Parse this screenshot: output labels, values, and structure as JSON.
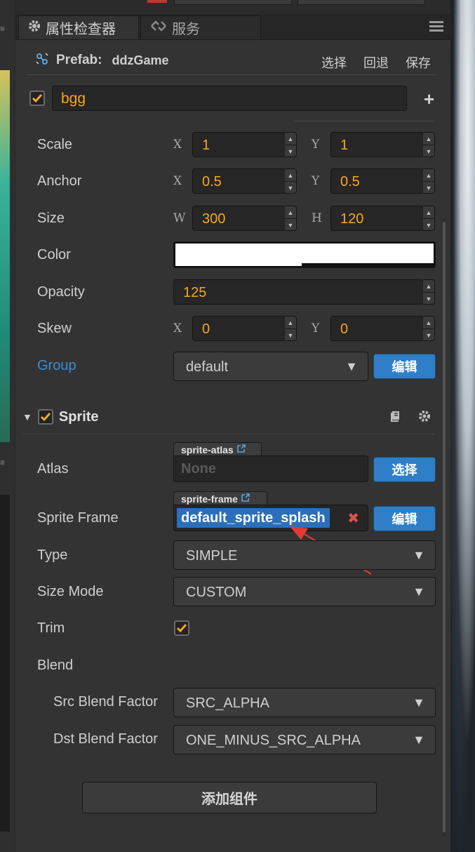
{
  "tabs": [
    {
      "label": "属性检查器",
      "icon": "gear-icon"
    },
    {
      "label": "服务",
      "icon": "link-icon"
    }
  ],
  "prefab": {
    "label": "Prefab:",
    "name": "ddzGame",
    "actions": [
      "选择",
      "回退",
      "保存"
    ]
  },
  "node": {
    "name": "bgg",
    "active": true
  },
  "properties": {
    "scale": {
      "label": "Scale",
      "x_label": "X",
      "x": "1",
      "y_label": "Y",
      "y": "1"
    },
    "anchor": {
      "label": "Anchor",
      "x_label": "X",
      "x": "0.5",
      "y_label": "Y",
      "y": "0.5"
    },
    "size": {
      "label": "Size",
      "w_label": "W",
      "w": "300",
      "h_label": "H",
      "h": "120"
    },
    "color": {
      "label": "Color",
      "value": "#ffffff",
      "alpha_fraction": 0.49
    },
    "opacity": {
      "label": "Opacity",
      "value": "125"
    },
    "skew": {
      "label": "Skew",
      "x_label": "X",
      "x": "0",
      "y_label": "Y",
      "y": "0"
    },
    "group": {
      "label": "Group",
      "value": "default",
      "edit_label": "编辑"
    }
  },
  "sprite": {
    "title": "Sprite",
    "enabled": true,
    "atlas": {
      "label": "Atlas",
      "tag": "sprite-atlas",
      "placeholder": "None",
      "select_label": "选择"
    },
    "sprite_frame": {
      "label": "Sprite Frame",
      "tag": "sprite-frame",
      "value": "default_sprite_splash",
      "edit_label": "编辑"
    },
    "type": {
      "label": "Type",
      "value": "SIMPLE"
    },
    "size_mode": {
      "label": "Size Mode",
      "value": "CUSTOM"
    },
    "trim": {
      "label": "Trim",
      "checked": true
    },
    "blend": {
      "label": "Blend"
    },
    "src_blend": {
      "label": "Src Blend Factor",
      "value": "SRC_ALPHA"
    },
    "dst_blend": {
      "label": "Dst Blend Factor",
      "value": "ONE_MINUS_SRC_ALPHA"
    }
  },
  "add_component_label": "添加组件",
  "colors": {
    "accent_orange": "#f6a623",
    "link_blue": "#3c8fd8",
    "button_blue": "#2f7fc8",
    "annotation_red": "#e53935"
  }
}
